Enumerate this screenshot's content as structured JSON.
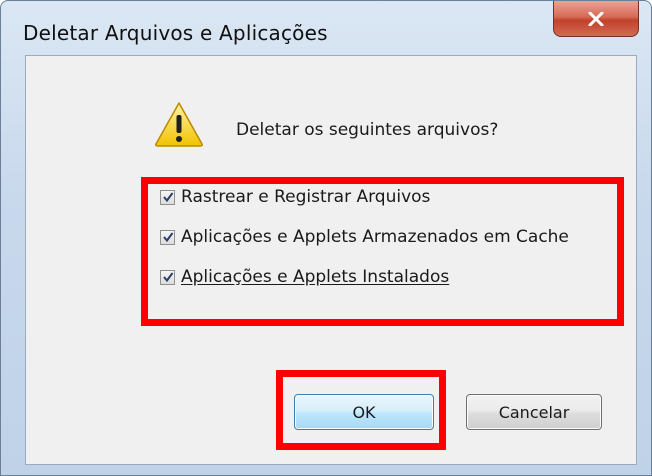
{
  "window": {
    "title": "Deletar Arquivos e Aplicações",
    "close_icon": "close-icon"
  },
  "dialog": {
    "icon": "warning-icon",
    "prompt": "Deletar os seguintes arquivos?",
    "options": [
      {
        "label": "Rastrear e Registrar Arquivos",
        "checked": true
      },
      {
        "label": "Aplicações e Applets Armazenados em Cache",
        "checked": true
      },
      {
        "label": "Aplicações e Applets Instalados",
        "checked": true
      }
    ],
    "ok_label": "OK",
    "cancel_label": "Cancelar"
  },
  "annotations": {
    "highlight_color": "#ff0000"
  }
}
